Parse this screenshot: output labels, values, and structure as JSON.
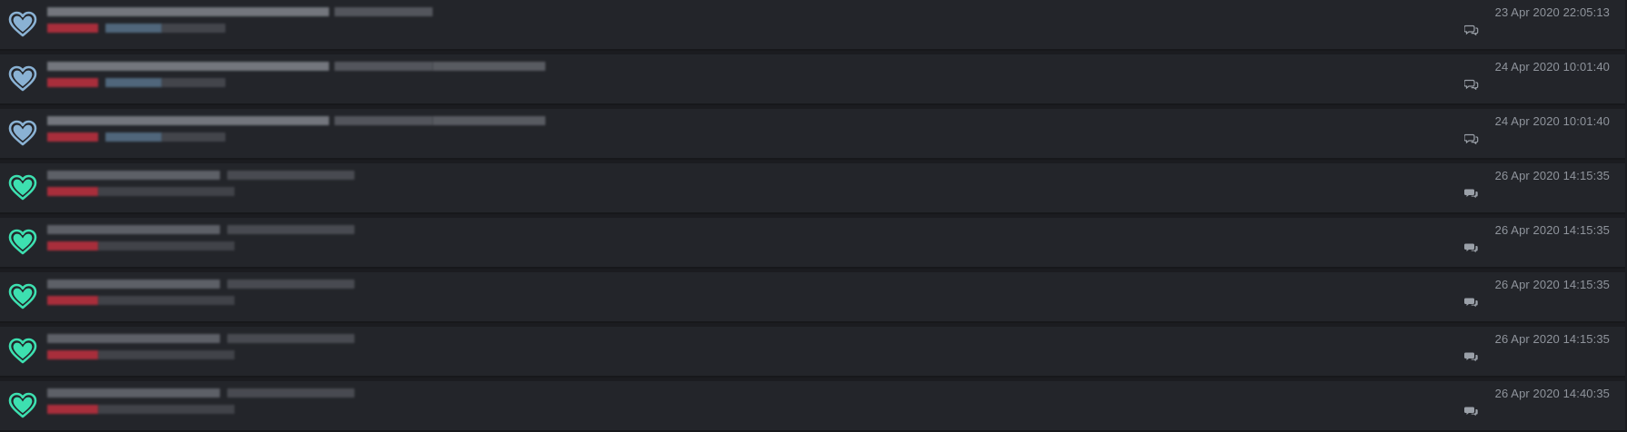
{
  "colors": {
    "heart_seen": "#8ab2d4",
    "heart_new": "#3de0b0",
    "redact_red": "#c0303f",
    "redact_blue": "#58728a",
    "redact_gray": "#8e9199"
  },
  "rows": [
    {
      "status": "seen",
      "heart_icon": "heart-icon",
      "timestamp": "23 Apr 2020 22:05:13",
      "comment_icon": "comments-outline-icon",
      "blue_tag": true
    },
    {
      "status": "seen",
      "heart_icon": "heart-icon",
      "timestamp": "24 Apr 2020 10:01:40",
      "comment_icon": "comments-outline-icon",
      "blue_tag": true
    },
    {
      "status": "seen",
      "heart_icon": "heart-icon",
      "timestamp": "24 Apr 2020 10:01:40",
      "comment_icon": "comments-outline-icon",
      "blue_tag": true
    },
    {
      "status": "new",
      "heart_icon": "heart-icon",
      "timestamp": "26 Apr 2020 14:15:35",
      "comment_icon": "comments-filled-icon",
      "blue_tag": false
    },
    {
      "status": "new",
      "heart_icon": "heart-icon",
      "timestamp": "26 Apr 2020 14:15:35",
      "comment_icon": "comments-filled-icon",
      "blue_tag": false
    },
    {
      "status": "new",
      "heart_icon": "heart-icon",
      "timestamp": "26 Apr 2020 14:15:35",
      "comment_icon": "comments-filled-icon",
      "blue_tag": false
    },
    {
      "status": "new",
      "heart_icon": "heart-icon",
      "timestamp": "26 Apr 2020 14:15:35",
      "comment_icon": "comments-filled-icon",
      "blue_tag": false
    },
    {
      "status": "new",
      "heart_icon": "heart-icon",
      "timestamp": "26 Apr 2020 14:40:35",
      "comment_icon": "comments-filled-icon",
      "blue_tag": false
    }
  ]
}
